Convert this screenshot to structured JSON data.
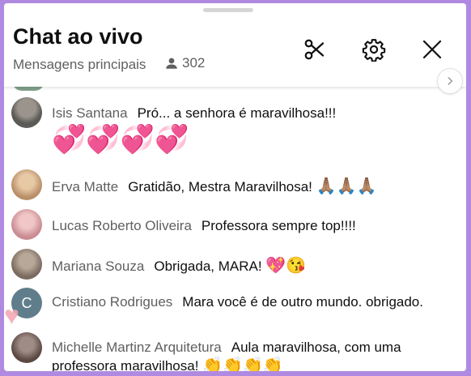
{
  "header": {
    "title": "Chat ao vivo",
    "subtitle": "Mensagens principais",
    "viewer_count": "302"
  },
  "icons": {
    "clip": "scissors-icon",
    "settings": "gear-icon",
    "close": "close-icon",
    "scroll": "chevron-right-icon",
    "viewers": "person-icon"
  },
  "messages": [
    {
      "author": "Isis Santana",
      "text": "Pró... a senhora é maravilhosa!!!",
      "emoji": "💞💞💞💞",
      "avatar_color": "#6d6a66"
    },
    {
      "author": "Erva Matte",
      "text": "Gratidão, Mestra Maravilhosa!",
      "emoji": "🙏🏽🙏🏽🙏🏽",
      "avatar_color": "#c9a27e"
    },
    {
      "author": "Lucas Roberto Oliveira",
      "text": "Professora sempre top!!!!",
      "emoji": "",
      "avatar_color": "#d7a0a6"
    },
    {
      "author": "Mariana Souza",
      "text": "Obrigada, MARA!",
      "emoji": "💖😘",
      "avatar_color": "#8a7b70"
    },
    {
      "author": "Cristiano Rodrigues",
      "text": "Mara você é de outro mundo. obrigado.",
      "emoji": "",
      "avatar_letter": "C",
      "avatar_color": "#607d8b"
    },
    {
      "author": "Michelle Martinz Arquitetura",
      "text": "Aula maravilhosa, com uma professora maravilhosa!",
      "emoji": "👏👏👏👏",
      "avatar_color": "#6b5a55"
    }
  ],
  "colors": {
    "border": "#b08ae0",
    "author": "#606060",
    "text": "#0f0f0f"
  }
}
